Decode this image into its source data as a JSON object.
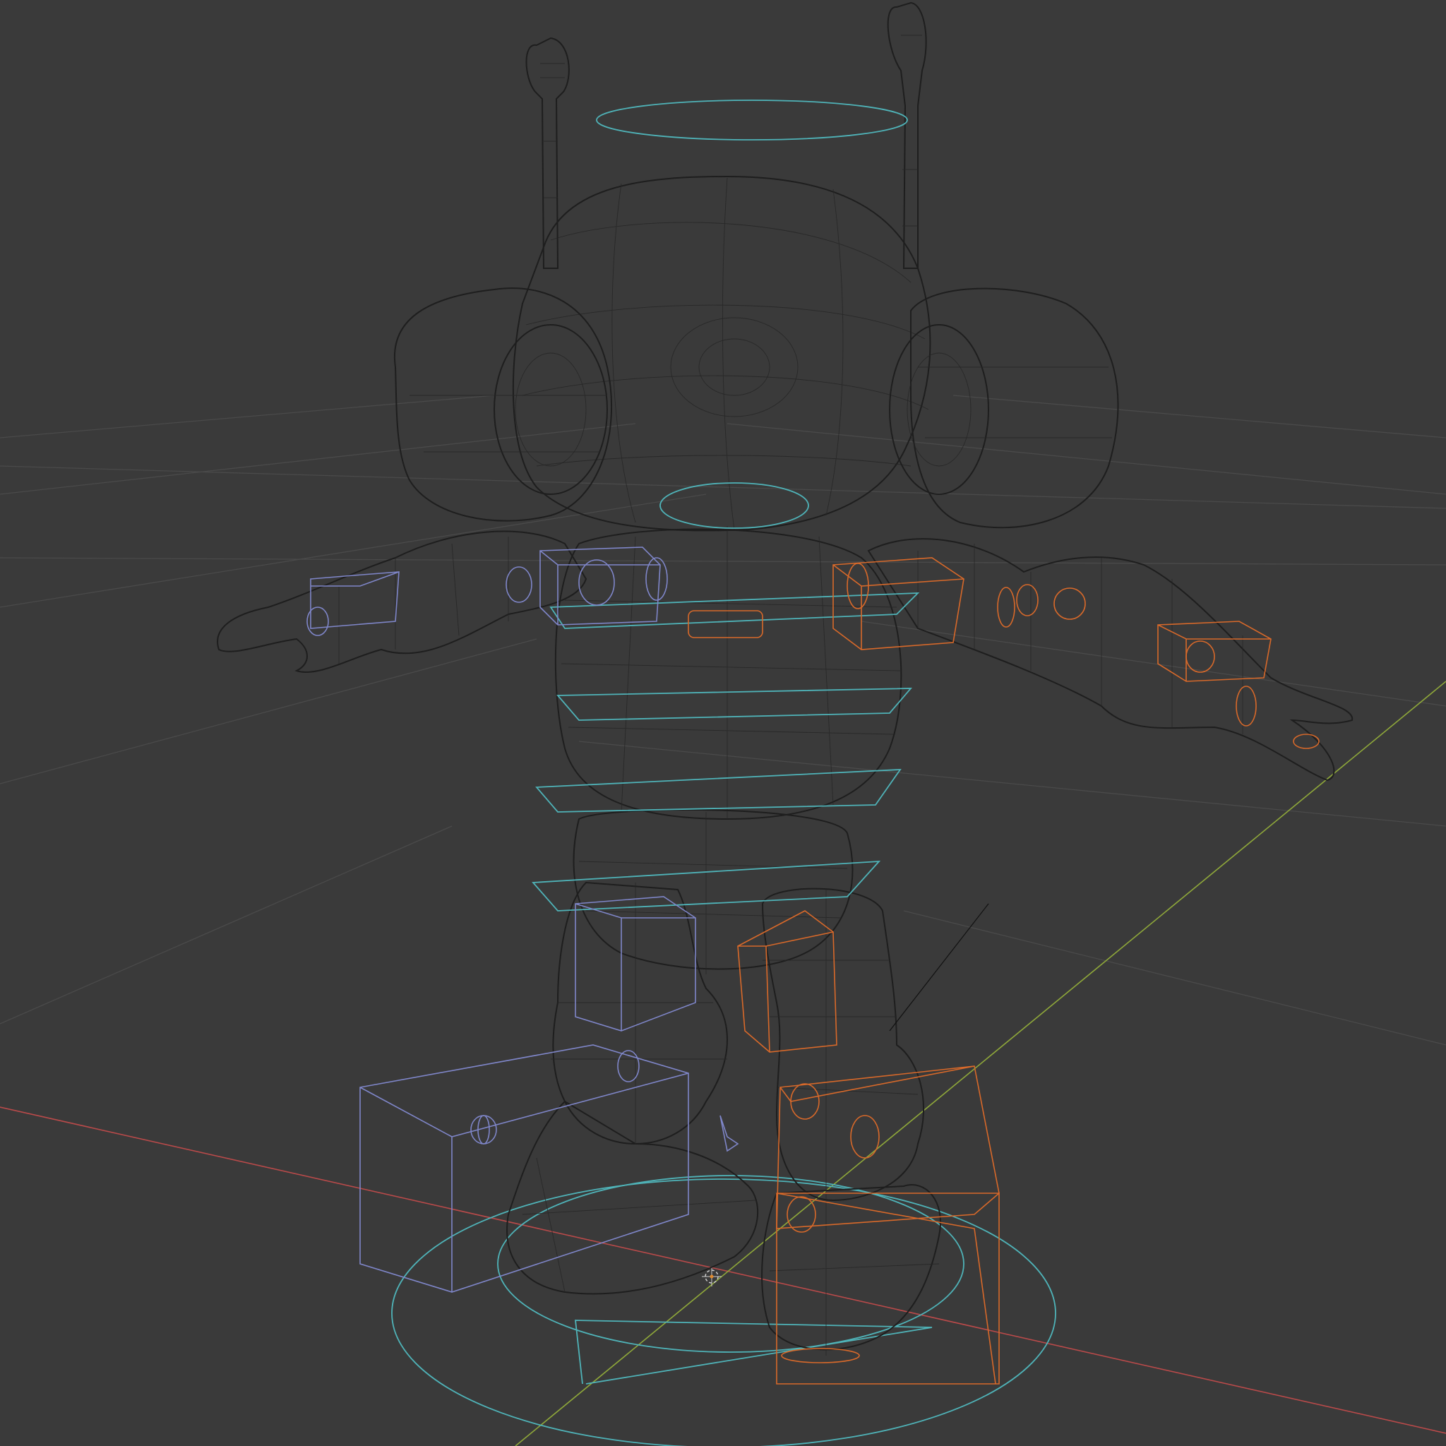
{
  "viewport": {
    "background_color": "#3a3a3a",
    "grid_color": "#4a4a4a",
    "x_axis_color": "#b94a4a",
    "y_axis_color": "#8fa83a",
    "wire_color": "#1e1e1e",
    "controls": {
      "center_color": "#4fb3b8",
      "left_side_color": "#7f86c9",
      "right_side_color": "#d8692a"
    },
    "object": {
      "kind": "rigged-robot-character",
      "display": "wireframe"
    }
  }
}
